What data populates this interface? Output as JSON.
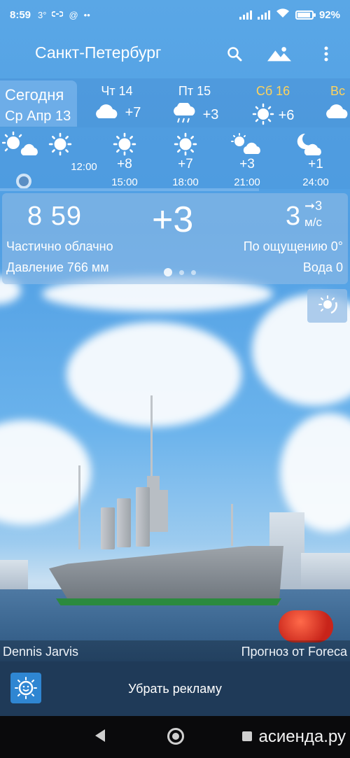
{
  "status_bar": {
    "time": "8:59",
    "indicator_1": "3°",
    "link_icon": "link-icon",
    "at_icon": "at-icon",
    "more_dots": "••",
    "battery": "92%",
    "battery_level": 0.92
  },
  "app_bar": {
    "city": "Санкт-Петербург",
    "search_icon": "search-icon",
    "scenery_icon": "landscape-icon",
    "menu_icon": "more-vertical-icon"
  },
  "days": {
    "today": {
      "label": "Сегодня",
      "date": "Ср Апр 13"
    },
    "items": [
      {
        "name": "Чт 14",
        "temp": "+7",
        "icon": "cloud-icon",
        "highlight": false
      },
      {
        "name": "Пт 15",
        "temp": "+3",
        "icon": "rain-cloud-icon",
        "highlight": false
      },
      {
        "name": "Сб 16",
        "temp": "+6",
        "icon": "sun-icon",
        "highlight": true
      },
      {
        "name": "Вс",
        "temp": "",
        "icon": "cloud-icon",
        "highlight": true
      }
    ]
  },
  "hours": [
    {
      "time": "",
      "temp": "",
      "icon": "sun-cloud-icon"
    },
    {
      "time": "12:00",
      "temp": "",
      "icon": "sun-icon"
    },
    {
      "time": "15:00",
      "temp": "+8",
      "icon": "sun-icon"
    },
    {
      "time": "18:00",
      "temp": "+7",
      "icon": "sun-icon"
    },
    {
      "time": "21:00",
      "temp": "+3",
      "icon": "sun-cloud-icon"
    },
    {
      "time": "24:00",
      "temp": "+1",
      "icon": "moon-cloud-icon"
    }
  ],
  "current": {
    "clock": "8 59",
    "temp": "+3",
    "wind_speed": "3",
    "wind_arrow": "➞3",
    "wind_unit": "м/с",
    "description": "Частично облачно",
    "feels_like": "По ощущению 0°",
    "pressure": "Давление 766 мм",
    "water": "Вода 0"
  },
  "credits": {
    "photo_author": "Dennis Jarvis",
    "provider": "Прогноз от Foreca"
  },
  "ads": {
    "label": "Убрать рекламу"
  },
  "watermark": "асиенда.ру",
  "colors": {
    "ads_bg": "#1f3a58",
    "highlight_day": "#ffd35c",
    "accent_blue": "#2f86d2"
  }
}
